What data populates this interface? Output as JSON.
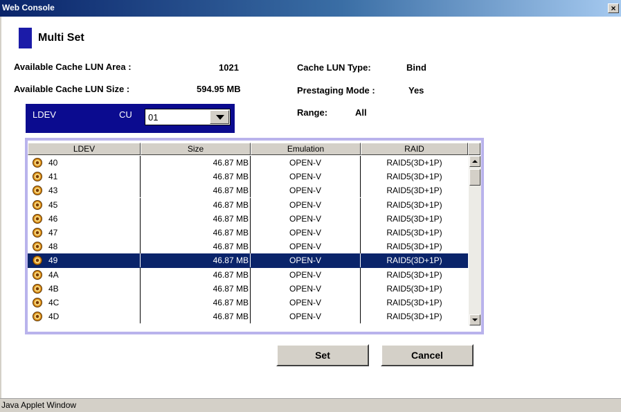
{
  "window": {
    "title": "Web Console",
    "close_label": "×"
  },
  "dialog": {
    "heading": "Multi Set",
    "info": {
      "area_label": "Available Cache LUN Area :",
      "area_value": "1021",
      "size_label": "Available Cache LUN Size :",
      "size_value": "594.95 MB",
      "type_label": "Cache LUN Type:",
      "type_value": "Bind",
      "prestaging_label": "Prestaging Mode :",
      "prestaging_value": "Yes",
      "range_label": "Range:",
      "range_value": "All"
    },
    "filter": {
      "ldev_label": "LDEV",
      "cu_label": "CU",
      "cu_value": "01"
    },
    "table": {
      "columns": [
        "LDEV",
        "Size",
        "Emulation",
        "RAID"
      ],
      "rows": [
        {
          "ldev": "40",
          "size": "46.87 MB",
          "emulation": "OPEN-V",
          "raid": "RAID5(3D+1P)"
        },
        {
          "ldev": "41",
          "size": "46.87 MB",
          "emulation": "OPEN-V",
          "raid": "RAID5(3D+1P)"
        },
        {
          "ldev": "43",
          "size": "46.87 MB",
          "emulation": "OPEN-V",
          "raid": "RAID5(3D+1P)"
        },
        {
          "ldev": "45",
          "size": "46.87 MB",
          "emulation": "OPEN-V",
          "raid": "RAID5(3D+1P)"
        },
        {
          "ldev": "46",
          "size": "46.87 MB",
          "emulation": "OPEN-V",
          "raid": "RAID5(3D+1P)"
        },
        {
          "ldev": "47",
          "size": "46.87 MB",
          "emulation": "OPEN-V",
          "raid": "RAID5(3D+1P)"
        },
        {
          "ldev": "48",
          "size": "46.87 MB",
          "emulation": "OPEN-V",
          "raid": "RAID5(3D+1P)"
        },
        {
          "ldev": "49",
          "size": "46.87 MB",
          "emulation": "OPEN-V",
          "raid": "RAID5(3D+1P)",
          "selected": true
        },
        {
          "ldev": "4A",
          "size": "46.87 MB",
          "emulation": "OPEN-V",
          "raid": "RAID5(3D+1P)"
        },
        {
          "ldev": "4B",
          "size": "46.87 MB",
          "emulation": "OPEN-V",
          "raid": "RAID5(3D+1P)"
        },
        {
          "ldev": "4C",
          "size": "46.87 MB",
          "emulation": "OPEN-V",
          "raid": "RAID5(3D+1P)"
        },
        {
          "ldev": "4D",
          "size": "46.87 MB",
          "emulation": "OPEN-V",
          "raid": "RAID5(3D+1P)"
        }
      ],
      "row_icon": "disk-icon"
    },
    "buttons": {
      "set_label": "Set",
      "cancel_label": "Cancel"
    }
  },
  "status_bar": {
    "text": "Java Applet Window"
  },
  "colors": {
    "title_bar": "#0a246a",
    "selection": "#0a246a",
    "panel": "#0b0b8f",
    "table_frame": "#b9b3ec"
  }
}
